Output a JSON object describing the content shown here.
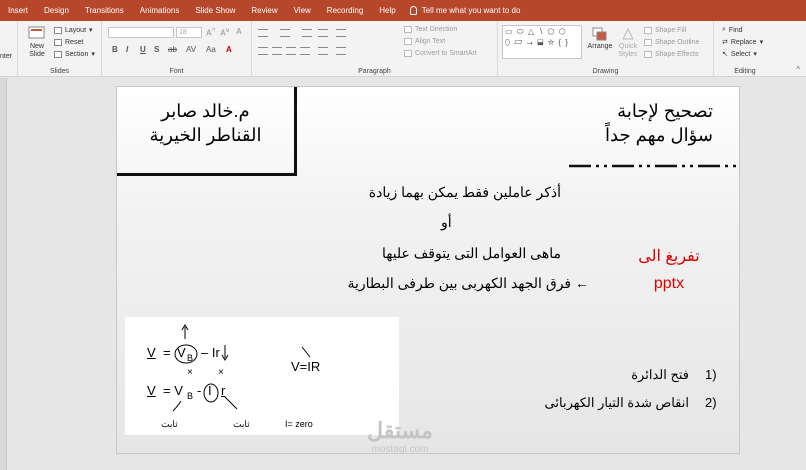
{
  "ribbon_tabs": [
    "Insert",
    "Design",
    "Transitions",
    "Animations",
    "Slide Show",
    "Review",
    "View",
    "Recording",
    "Help"
  ],
  "tell_me": "Tell me what you want to do",
  "clipboard": {
    "partial_label": "nter"
  },
  "slides": {
    "new_slide": "New",
    "new_slide_2": "Slide",
    "layout": "Layout",
    "reset": "Reset",
    "section": "Section",
    "group_label": "Slides"
  },
  "font": {
    "size": "18",
    "group_label": "Font"
  },
  "paragraph": {
    "text_direction": "Text Direction",
    "align_text": "Align Text",
    "convert_smartart": "Convert to SmartArt",
    "group_label": "Paragraph"
  },
  "drawing": {
    "arrange": "Arrange",
    "quick_styles": "Quick",
    "quick_styles_2": "Styles",
    "shape_fill": "Shape Fill",
    "shape_outline": "Shape Outline",
    "shape_effects": "Shape Effects",
    "group_label": "Drawing"
  },
  "editing": {
    "find": "Find",
    "replace": "Replace",
    "select": "Select",
    "group_label": "Editing"
  },
  "slide": {
    "author": "م.خالد صابر",
    "place": "القناطر الخيرية",
    "title": "تصحيح لإجابة",
    "subtitle": "سؤال مهم جداً",
    "question": "أذكر عاملين فقط يمكن بهما زيادة",
    "or": "أو",
    "question2": "ماهى العوامل التى يتوقف عليها",
    "answer": "← فرق الجهد الكهربى بين طرفى البطارية",
    "note_line1": "تفريغ الى",
    "note_line2": "pptx",
    "formula": {
      "eq1_v": "V",
      "eq1_vb": "V",
      "eq1_sub": "B",
      "eq1_ir": "– Ir",
      "eq2": "V=IR",
      "eq3_v": "V",
      "eq3_vb": "= V",
      "eq3_sub": "B",
      "eq3_minus": "-",
      "eq3_i": "I",
      "eq3_r": "r",
      "const1": "ثابت",
      "const2": "ثابت",
      "izero": "I= zero"
    },
    "list": [
      {
        "num": "1)",
        "text": "فتح الدائرة"
      },
      {
        "num": "2)",
        "text": "انقاص شدة التيار الكهربائى"
      }
    ]
  },
  "watermark": {
    "main": "مستقل",
    "sub": "mostaql.com"
  },
  "colors": {
    "ribbon_tab_bg": "#b7472a",
    "note_red": "#e00000"
  }
}
